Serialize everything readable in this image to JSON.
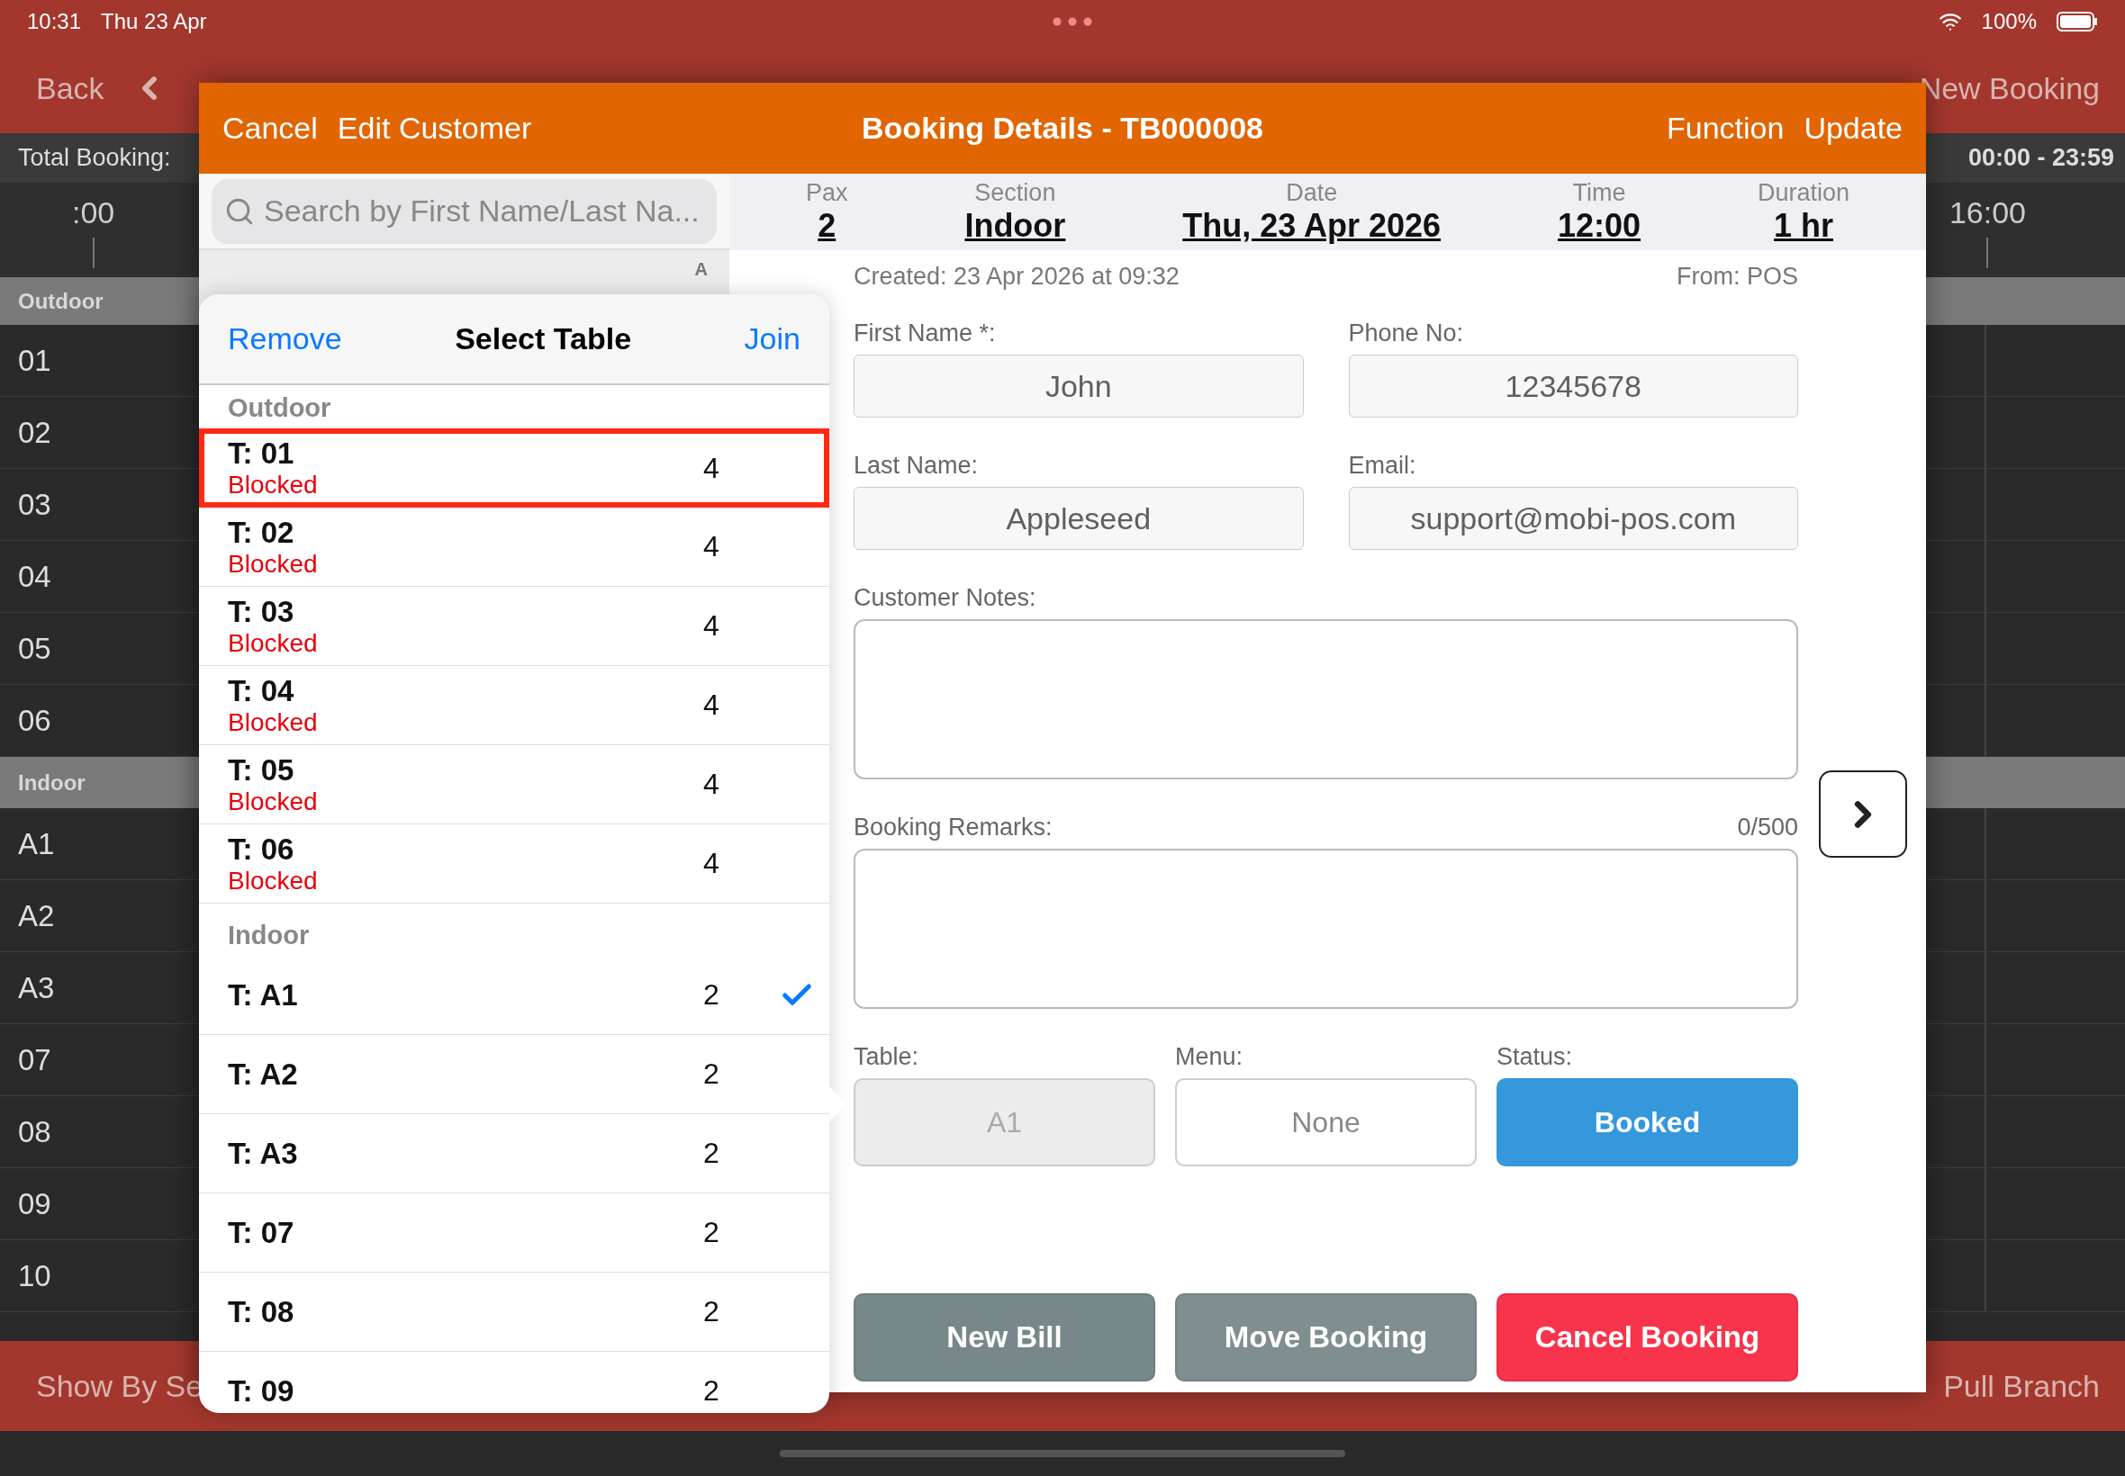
{
  "status_bar": {
    "time": "10:31",
    "date": "Thu 23 Apr",
    "battery": "100%"
  },
  "nav": {
    "back": "Back",
    "new_booking": "New Booking"
  },
  "summary": {
    "label": "Total Booking:",
    "range": "00:00 - 23:59"
  },
  "timeline": {
    "ticks": [
      ":00",
      "16:00"
    ]
  },
  "sections": [
    {
      "name": "Outdoor",
      "tables": [
        "01",
        "02",
        "03",
        "04",
        "05",
        "06"
      ]
    },
    {
      "name": "Indoor",
      "tables": [
        "A1",
        "A2",
        "A3",
        "07",
        "08",
        "09",
        "10"
      ]
    }
  ],
  "bottom_bar": {
    "left": "Show By Se",
    "right": "Pull Branch"
  },
  "modal": {
    "title": "Booking Details - TB000008",
    "left_actions": [
      "Cancel",
      "Edit Customer"
    ],
    "right_actions": [
      "Function",
      "Update"
    ],
    "search": {
      "placeholder": "Search by First Name/Last Na..."
    },
    "index_letter": "A",
    "details": [
      {
        "label": "Pax",
        "value": "2"
      },
      {
        "label": "Section",
        "value": "Indoor"
      },
      {
        "label": "Date",
        "value": "Thu, 23 Apr 2026"
      },
      {
        "label": "Time",
        "value": "12:00"
      },
      {
        "label": "Duration",
        "value": "1 hr"
      }
    ],
    "created": "Created: 23 Apr 2026 at 09:32",
    "source": "From: POS",
    "fields": [
      {
        "label": "First Name *:",
        "value": "John"
      },
      {
        "label": "Phone No:",
        "value": "12345678"
      },
      {
        "label": "Last Name:",
        "value": "Appleseed"
      },
      {
        "label": "Email:",
        "value": "support@mobi-pos.com"
      }
    ],
    "notes": {
      "label": "Customer Notes:"
    },
    "remarks": {
      "label": "Booking Remarks:",
      "count": "0/500"
    },
    "selectors": [
      {
        "label": "Table:",
        "value": "A1",
        "kind": "field",
        "disabled": true
      },
      {
        "label": "Menu:",
        "value": "None",
        "kind": "field",
        "disabled": false
      },
      {
        "label": "Status:",
        "value": "Booked",
        "kind": "button"
      }
    ],
    "actions": [
      {
        "label": "New Bill",
        "color": "#77878a"
      },
      {
        "label": "Move Booking",
        "color": "#818e8f"
      },
      {
        "label": "Cancel Booking",
        "color": "#f8344c"
      }
    ]
  },
  "popover": {
    "remove": "Remove",
    "title": "Select Table",
    "join": "Join",
    "groups": [
      {
        "name": "Outdoor",
        "tables": [
          {
            "name": "T: 01",
            "status": "Blocked",
            "seats": "4",
            "selected": false,
            "highlighted": true
          },
          {
            "name": "T: 02",
            "status": "Blocked",
            "seats": "4",
            "selected": false,
            "highlighted": false
          },
          {
            "name": "T: 03",
            "status": "Blocked",
            "seats": "4",
            "selected": false,
            "highlighted": false
          },
          {
            "name": "T: 04",
            "status": "Blocked",
            "seats": "4",
            "selected": false,
            "highlighted": false
          },
          {
            "name": "T: 05",
            "status": "Blocked",
            "seats": "4",
            "selected": false,
            "highlighted": false
          },
          {
            "name": "T: 06",
            "status": "Blocked",
            "seats": "4",
            "selected": false,
            "highlighted": false
          }
        ]
      },
      {
        "name": "Indoor",
        "tables": [
          {
            "name": "T: A1",
            "seats": "2",
            "selected": true,
            "highlighted": false
          },
          {
            "name": "T: A2",
            "seats": "2",
            "selected": false,
            "highlighted": false
          },
          {
            "name": "T: A3",
            "seats": "2",
            "selected": false,
            "highlighted": false
          },
          {
            "name": "T: 07",
            "seats": "2",
            "selected": false,
            "highlighted": false
          },
          {
            "name": "T: 08",
            "seats": "2",
            "selected": false,
            "highlighted": false
          },
          {
            "name": "T: 09",
            "seats": "2",
            "selected": false,
            "highlighted": false
          }
        ]
      }
    ]
  }
}
